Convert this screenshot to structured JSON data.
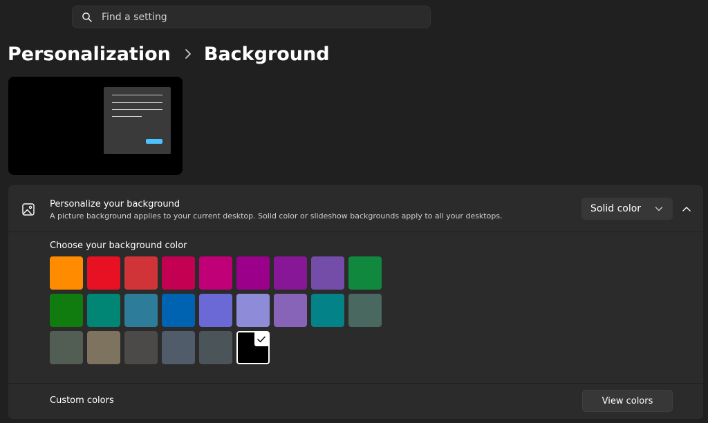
{
  "search": {
    "placeholder": "Find a setting"
  },
  "breadcrumb": {
    "parent": "Personalization",
    "current": "Background"
  },
  "background_setting": {
    "title": "Personalize your background",
    "description": "A picture background applies to your current desktop. Solid color or slideshow backgrounds apply to all your desktops.",
    "dropdown_value": "Solid color"
  },
  "colors": {
    "label": "Choose your background color",
    "swatches": [
      [
        "#ff8c00",
        "#e81123",
        "#d13438",
        "#c30052",
        "#bf0077",
        "#9a0089",
        "#881798",
        "#744da9",
        "#10893e"
      ],
      [
        "#107c10",
        "#018574",
        "#2d7d9a",
        "#0063b1",
        "#6b69d6",
        "#8e8cd8",
        "#8764b8",
        "#038387",
        "#486860"
      ],
      [
        "#525e54",
        "#7e735f",
        "#4c4a48",
        "#515c6b",
        "#4a5459",
        "#000000"
      ]
    ],
    "selected": "#000000"
  },
  "custom_colors": {
    "label": "Custom colors",
    "button": "View colors"
  }
}
